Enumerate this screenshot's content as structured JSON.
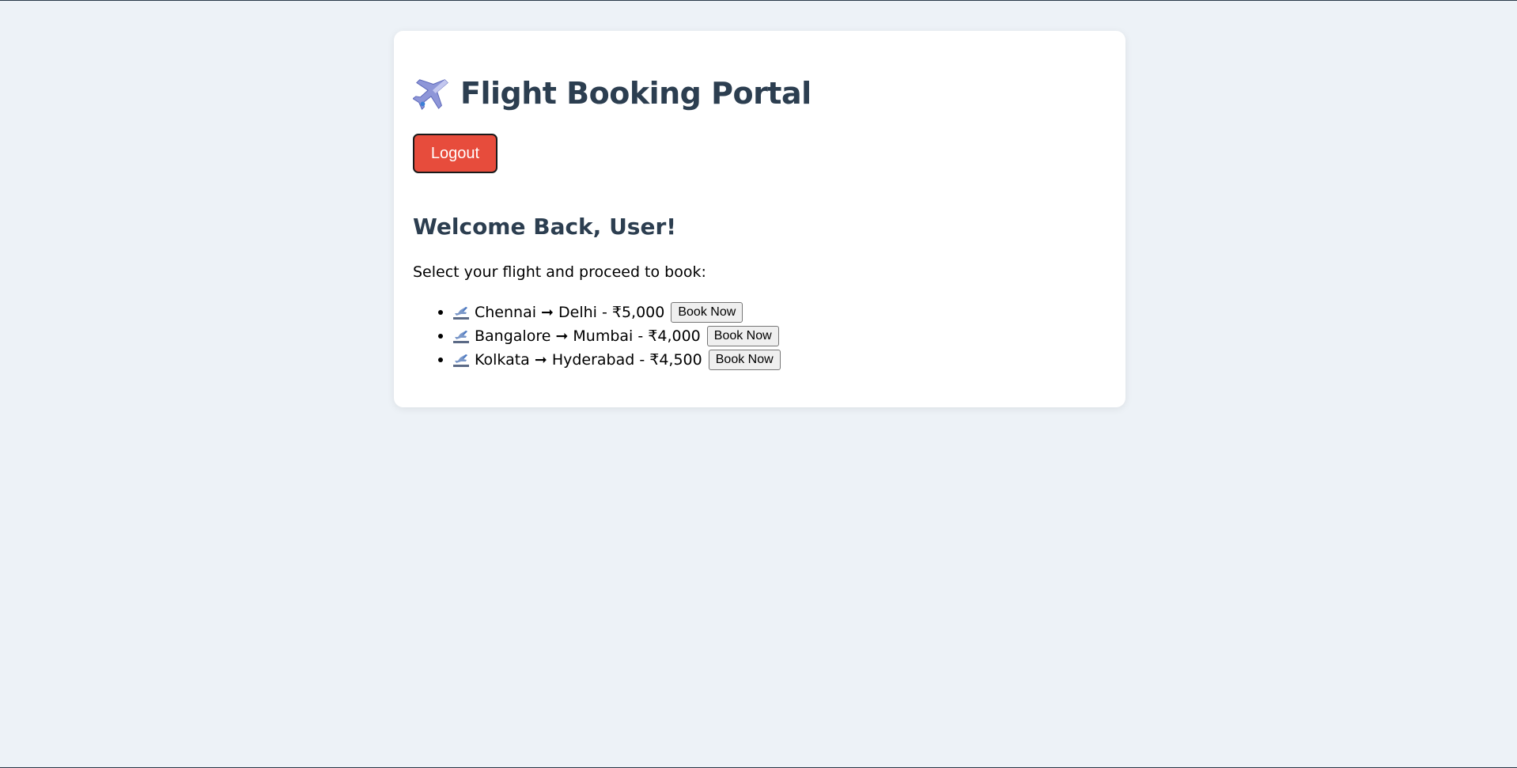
{
  "header": {
    "title": "Flight Booking Portal",
    "title_icon": "airplane-icon"
  },
  "actions": {
    "logout_label": "Logout"
  },
  "colors": {
    "logout_bg": "#e74c3c",
    "heading": "#2c3e50",
    "page_bg": "#edf2f7"
  },
  "main": {
    "welcome": "Welcome Back, User!",
    "instructions": "Select your flight and proceed to book:",
    "flights": [
      {
        "route": "Chennai ➞ Delhi - ₹5,000",
        "button": "Book Now",
        "icon": "departure-icon"
      },
      {
        "route": "Bangalore ➞ Mumbai - ₹4,000",
        "button": "Book Now",
        "icon": "departure-icon"
      },
      {
        "route": "Kolkata ➞ Hyderabad - ₹4,500",
        "button": "Book Now",
        "icon": "departure-icon"
      }
    ]
  }
}
